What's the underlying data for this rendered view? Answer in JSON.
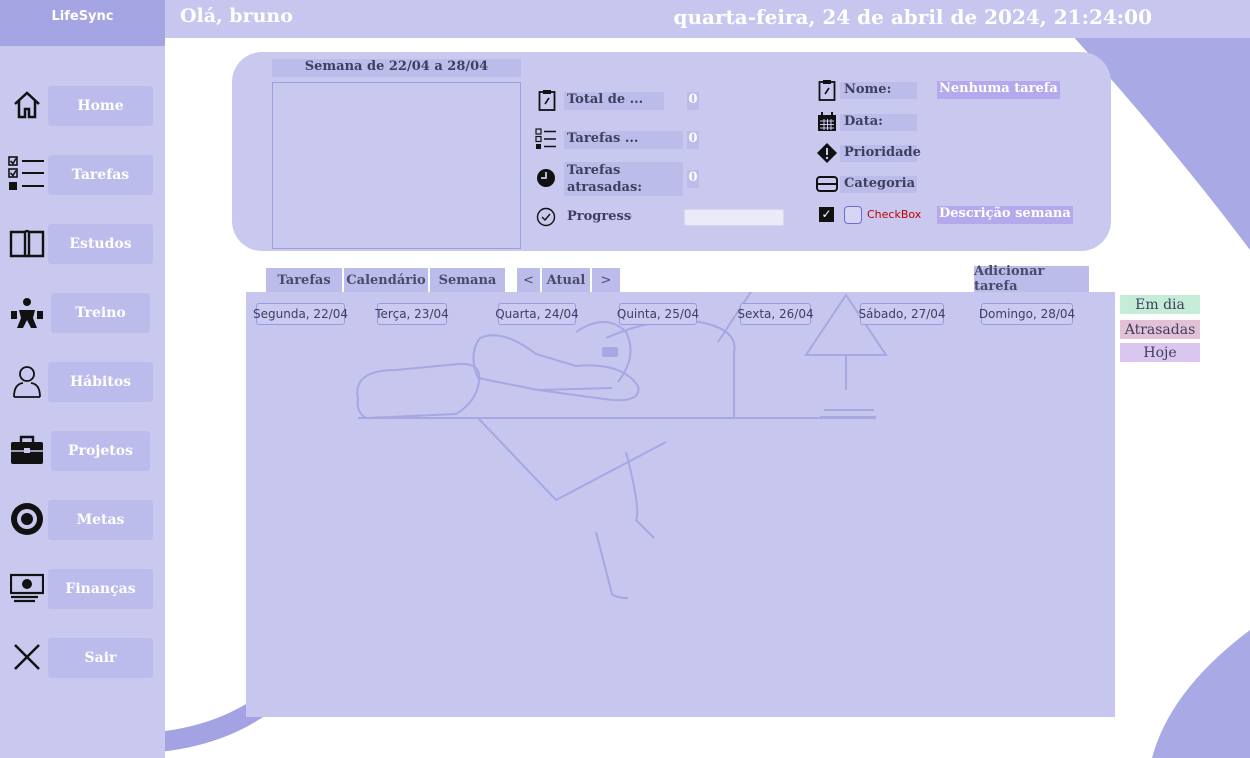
{
  "app": {
    "brand": "LifeSync"
  },
  "header": {
    "greeting": "Olá, bruno",
    "datetime": "quarta-feira, 24 de abril de 2024, 21:24:00"
  },
  "sidebar": {
    "items": [
      {
        "label": "Home",
        "icon": "home-icon"
      },
      {
        "label": "Tarefas",
        "icon": "checklist-icon"
      },
      {
        "label": "Estudos",
        "icon": "book-icon"
      },
      {
        "label": "Treino",
        "icon": "workout-icon"
      },
      {
        "label": "Hábitos",
        "icon": "person-icon"
      },
      {
        "label": "Projetos",
        "icon": "briefcase-icon"
      },
      {
        "label": "Metas",
        "icon": "target-icon"
      },
      {
        "label": "Finanças",
        "icon": "money-icon"
      },
      {
        "label": "Sair",
        "icon": "close-icon"
      }
    ]
  },
  "summary": {
    "week_title": "Semana de 22/04 a 28/04",
    "stats": [
      {
        "label": "Total de ...",
        "value": "0",
        "icon": "clipboard-icon"
      },
      {
        "label": "Tarefas ...",
        "value": "0",
        "icon": "checklist-icon"
      },
      {
        "label": "Tarefas atrasadas:",
        "value": "0",
        "icon": "clock-icon"
      },
      {
        "label": "Progresso",
        "icon": "check-circle-icon",
        "progress": 0
      }
    ],
    "details": {
      "name_label": "Nome:",
      "name_value": "Nenhuma tarefa",
      "date_label": "Data:",
      "priority_label": "Prioridade",
      "category_label": "Categoria",
      "checkbox_label": "CheckBox",
      "description_value": "Descrição semana"
    }
  },
  "tabs": {
    "items": [
      "Tarefas",
      "Calendário",
      "Semana"
    ],
    "prev": "<",
    "current": "Atual",
    "next": ">",
    "add_task": "Adicionar tarefa"
  },
  "calendar": {
    "days": [
      "Segunda, 22/04",
      "Terça, 23/04",
      "Quarta, 24/04",
      "Quinta, 25/04",
      "Sexta, 26/04",
      "Sábado, 27/04",
      "Domingo, 28/04"
    ]
  },
  "legend": [
    {
      "label": "Em dia",
      "color": "#c5ecd7"
    },
    {
      "label": "Atrasadas",
      "color": "#e2c1d6"
    },
    {
      "label": "Hoje",
      "color": "#dac6ee"
    }
  ],
  "colors": {
    "accent": "#a5a5e4",
    "panel": "#c9c9ef"
  }
}
